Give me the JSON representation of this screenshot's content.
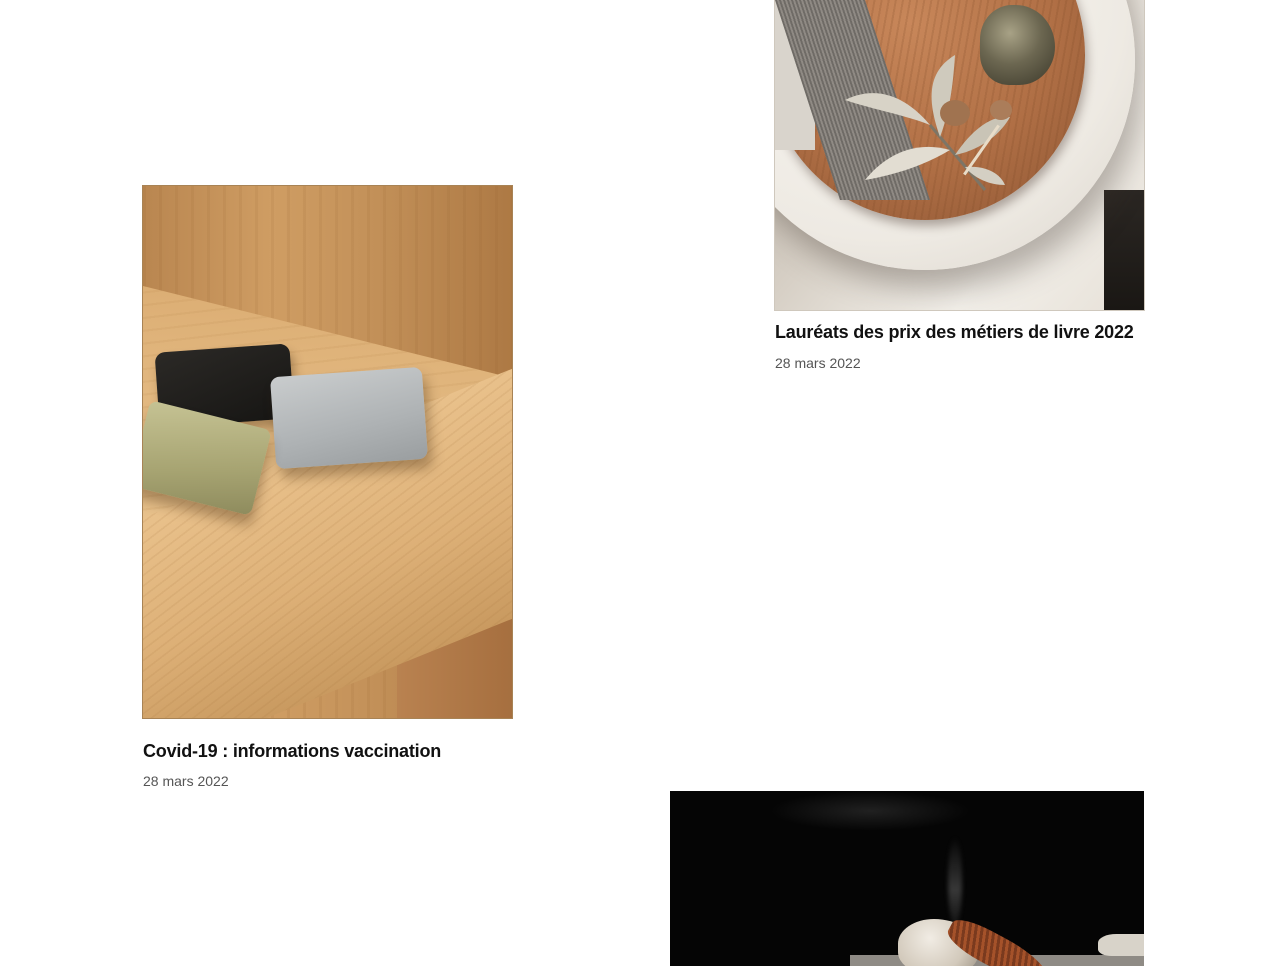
{
  "articles": [
    {
      "title": "Lauréats des prix des métiers de livre 2022",
      "date": "28 mars 2022",
      "image_alt": "Plateau en bois avec sauge, résine et pierre sur une assiette blanche"
    },
    {
      "title": "Covid-19 : informations vaccination",
      "date": "28 mars 2022",
      "image_alt": "Savons posés sur une étagère en bois clair"
    },
    {
      "image_alt": "Encens fumant sur une pierre blanche, fond noir"
    }
  ],
  "colors": {
    "background": "#ffffff",
    "title": "#111111",
    "date": "#555555"
  }
}
